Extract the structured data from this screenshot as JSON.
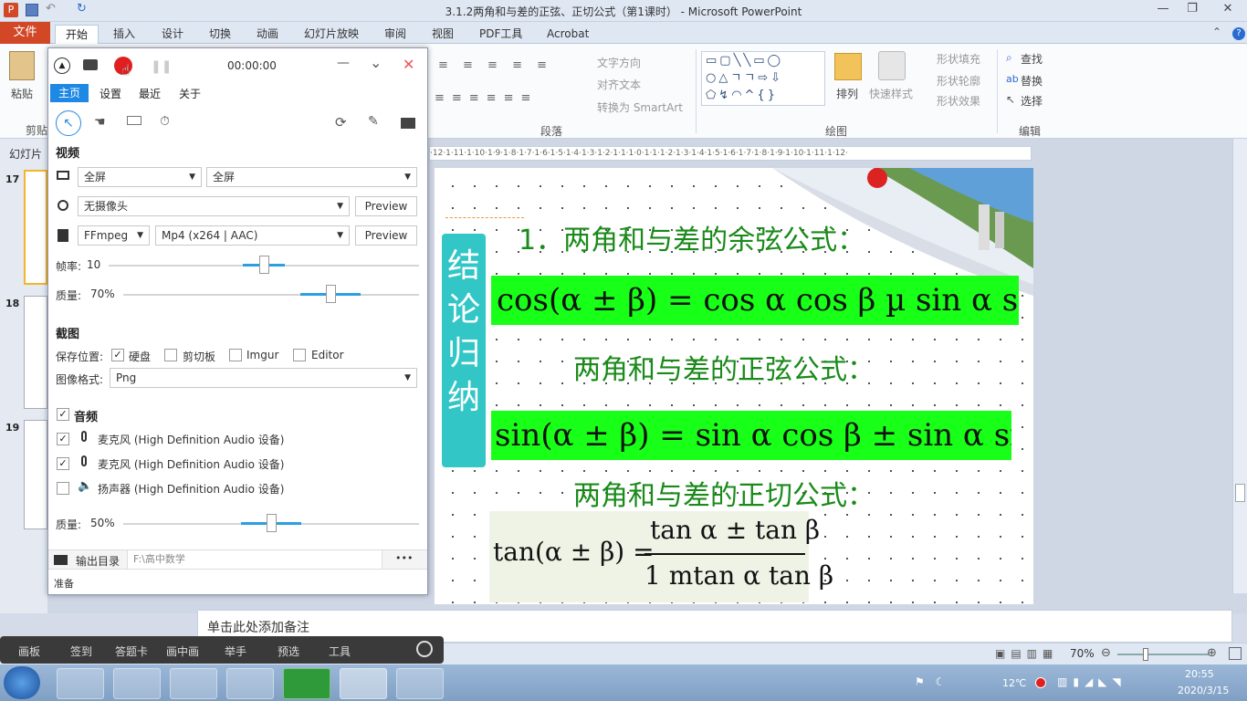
{
  "window": {
    "title": "3.1.2两角和与差的正弦、正切公式（第1课时） - Microsoft PowerPoint",
    "min": "—",
    "restore": "❐",
    "close": "✕"
  },
  "ribbon": {
    "tabs": [
      "文件",
      "开始",
      "插入",
      "设计",
      "切换",
      "动画",
      "幻灯片放映",
      "审阅",
      "视图",
      "PDF工具",
      "Acrobat"
    ],
    "paste": "粘贴",
    "clipboard": "剪贴",
    "text_direction": "文字方向",
    "align_text": "对齐文本",
    "smartart": "转换为 SmartArt",
    "paragraph": "段落",
    "arrange": "排列",
    "quick_styles": "快速样式",
    "shape_fill": "形状填充",
    "shape_outline": "形状轮廓",
    "shape_effects": "形状效果",
    "drawing": "绘图",
    "find": "查找",
    "replace": "替换",
    "select": "选择",
    "editing": "编辑"
  },
  "left_pane": {
    "header": "幻灯片",
    "slide_numbers": [
      "17",
      "18",
      "19"
    ]
  },
  "ruler": "·12·1·11·1·10·1·9·1·8·1·7·1·6·1·5·1·4·1·3·1·2·1·1·1·0·1·1·1·2·1·3·1·4·1·5·1·6·1·7·1·8·1·9·1·10·1·11·1·12·",
  "slide": {
    "side_label": [
      "结",
      "论",
      "归",
      "纳"
    ],
    "heading1": "1．两角和与差的余弦公式：",
    "formula1": "cos(α ± β) = cos α cos β µ sin α sin β",
    "heading2": "两角和与差的正弦公式：",
    "formula2": "sin(α ± β) = sin α cos β ± sin α sin β",
    "heading3": "两角和与差的正切公式：",
    "formula3_lhs": "tan(α ± β) =",
    "formula3_num": "tan α ± tan β",
    "formula3_den": "1 mtan α tan β"
  },
  "notes": {
    "placeholder": "单击此处添加备注"
  },
  "status": {
    "zoom": "70%"
  },
  "recorder": {
    "timer": "00:00:00",
    "tabs": [
      "主页",
      "设置",
      "最近",
      "关于"
    ],
    "video_section": "视频",
    "screen_option1": "全屏",
    "screen_option2": "全屏",
    "camera": "无摄像头",
    "preview1": "Preview",
    "encoder": "FFmpeg",
    "format": "Mp4 (x264 | AAC)",
    "preview2": "Preview",
    "framerate_label": "帧率:",
    "framerate": "10",
    "framerate_level": 0.5,
    "quality_label": "质量:",
    "quality": "70%",
    "quality_level": 0.7,
    "screenshot_section": "截图",
    "save_location": "保存位置:",
    "disk": "硬盘",
    "clipboard": "剪切板",
    "imgur": "Imgur",
    "editor": "Editor",
    "image_format_label": "图像格式:",
    "image_format": "Png",
    "audio_section": "音频",
    "mic1": "麦克风 (High Definition Audio 设备)",
    "mic2": "麦克风 (High Definition Audio 设备)",
    "speaker": "扬声器 (High Definition Audio 设备)",
    "audio_quality_label": "质量:",
    "audio_quality": "50%",
    "audio_quality_level": 0.5,
    "output_dir_label": "输出目录",
    "output_dir": "F:\\高中数学",
    "more": "•••",
    "status": "准备"
  },
  "bottom_toolbar": {
    "items": [
      "画板",
      "签到",
      "答题卡",
      "画中画",
      "举手",
      "预选",
      "工具"
    ]
  },
  "taskbar": {
    "apps": [
      "explorer",
      "chrome",
      "paint",
      "obs",
      "pdf",
      "powerpoint",
      "app"
    ],
    "temp": "12℃",
    "time": "20:55",
    "date": "2020/3/15"
  },
  "colors": {
    "file_tab": "#d24726",
    "formula_bg": "#18ff18",
    "heading_text": "#1a8a1a",
    "side_label_bg": "#33c6c6",
    "record_red": "#e02020"
  }
}
